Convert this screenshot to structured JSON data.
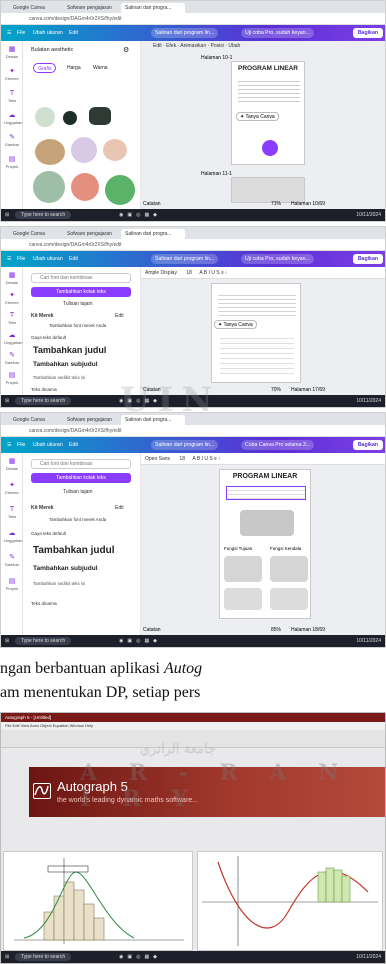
{
  "shot1": {
    "tabs": [
      "Google Canva",
      "Sofware pengajaran",
      "Salinan dari progra..."
    ],
    "url": "canva.com/design/DAGm4r0r2XS/fhy/edit",
    "menu": {
      "file": "File",
      "resize": "Ubah ukuran",
      "edit": "Edit",
      "title": "Salinan dari program lin...",
      "pro": "Uji coba Pro, sudah keyan...",
      "share": "Bagikan"
    },
    "rail": [
      "Desain",
      "Elemen",
      "Teks",
      "Unggahan",
      "Gambar",
      "Proyek"
    ],
    "panel_title": "Bulatan aesthetic",
    "filter_chip": "Grafis",
    "filter_price": "Harga",
    "filter_color": "Warna",
    "toolbar": [
      "Edit",
      "Efek",
      "Animasikan",
      "Posisi",
      "Ubah"
    ],
    "slide_label_1": "Halaman 10-1",
    "slide_label_2": "Halaman 11-1",
    "slide_title": "PROGRAM LINEAR",
    "tanya": "Tanya Canva",
    "notes": "Catatan",
    "page_count": "Halaman 10/69",
    "zoom": "71%",
    "tb_search": "Type here to search",
    "tb_time": "10/11/2024"
  },
  "shot2": {
    "tabs": [
      "Google Canva",
      "Sofware pengajaran",
      "Salinan dari progra..."
    ],
    "url": "canva.com/design/DAGm4r0r2XS/fhy/edit",
    "menu": {
      "file": "File",
      "resize": "Ubah ukuran",
      "edit": "Edit",
      "title": "Salinan dari program lin...",
      "pro": "Uji coba Pro, sudah keyan...",
      "share": "Bagikan"
    },
    "rail": [
      "Desain",
      "Elemen",
      "Teks",
      "Unggahan",
      "Gambar",
      "Proyek"
    ],
    "search": "Cari font dan kombinasi",
    "add_text": "Tambahkan kotak teks",
    "tulisan": "Tulisan tajam",
    "kit": "Kit Merek",
    "kit_edit": "Edit",
    "kit_sub": "Tambahkan font merek Anda",
    "default_styles": "Gaya teks default",
    "heading": "Tambahkan judul",
    "subheading": "Tambahkan subjudul",
    "body": "Tambahkan sedikit teks isi",
    "dynamic": "Teks dinamis",
    "font_name": "Ample Display",
    "font_size": "18",
    "tanya": "Tanya Canva",
    "notes": "Catatan",
    "page_count": "Halaman 17/69",
    "zoom": "70%",
    "tb_search": "Type here to search",
    "tb_time": "10/11/2024"
  },
  "shot3": {
    "tabs": [
      "Google Canva",
      "Sofware pengajaran",
      "Salinan dari progra..."
    ],
    "url": "canva.com/design/DAGm4r0r2XS/fhy/edit",
    "menu": {
      "file": "File",
      "resize": "Ubah ukuran",
      "edit": "Edit",
      "title": "Salinan dari program lin...",
      "pro": "Coba Canva Pro selama 3...",
      "share": "Bagikan"
    },
    "rail": [
      "Desain",
      "Elemen",
      "Teks",
      "Unggahan",
      "Gambar",
      "Proyek"
    ],
    "search": "Cari font dan kombinasi",
    "add_text": "Tambahkan kotak teks",
    "tulisan": "Tulisan tajam",
    "kit": "Kit Merek",
    "kit_edit": "Edit",
    "kit_sub": "Tambahkan font merek Anda",
    "default_styles": "Gaya teks default",
    "heading": "Tambahkan judul",
    "subheading": "Tambahkan subjudul",
    "body": "Tambahkan sedikit teks isi",
    "dynamic": "Teks dinamis",
    "font_name": "Open Sans",
    "font_size": "18",
    "slide_title": "PROGRAM LINEAR",
    "label_a": "Fungsi Tujuan",
    "label_b": "Fungsi Kendala",
    "notes": "Catatan",
    "page_count": "Halaman 18/69",
    "zoom": "85%",
    "tb_search": "Type here to search",
    "tb_time": "10/11/2024"
  },
  "paragraph": {
    "line1_a": "ngan berbantuan aplikasi ",
    "line1_italic": "Autog",
    "line2": "am menentukan DP, setiap pers"
  },
  "autograph": {
    "window_title": "Autograph 5 - [Untitled]",
    "menu": "File Edit View Axes Object Equation Window Help",
    "name": "Autograph 5",
    "tagline": "the world's leading dynamic maths software..."
  },
  "watermark": {
    "arabic": "جامعة الرانري",
    "latin": "A R - R A N I R Y"
  },
  "colors": {
    "canva_purple": "#8b3dff",
    "canva_teal": "#00a6c8",
    "autograph_red": "#7a1a18"
  }
}
